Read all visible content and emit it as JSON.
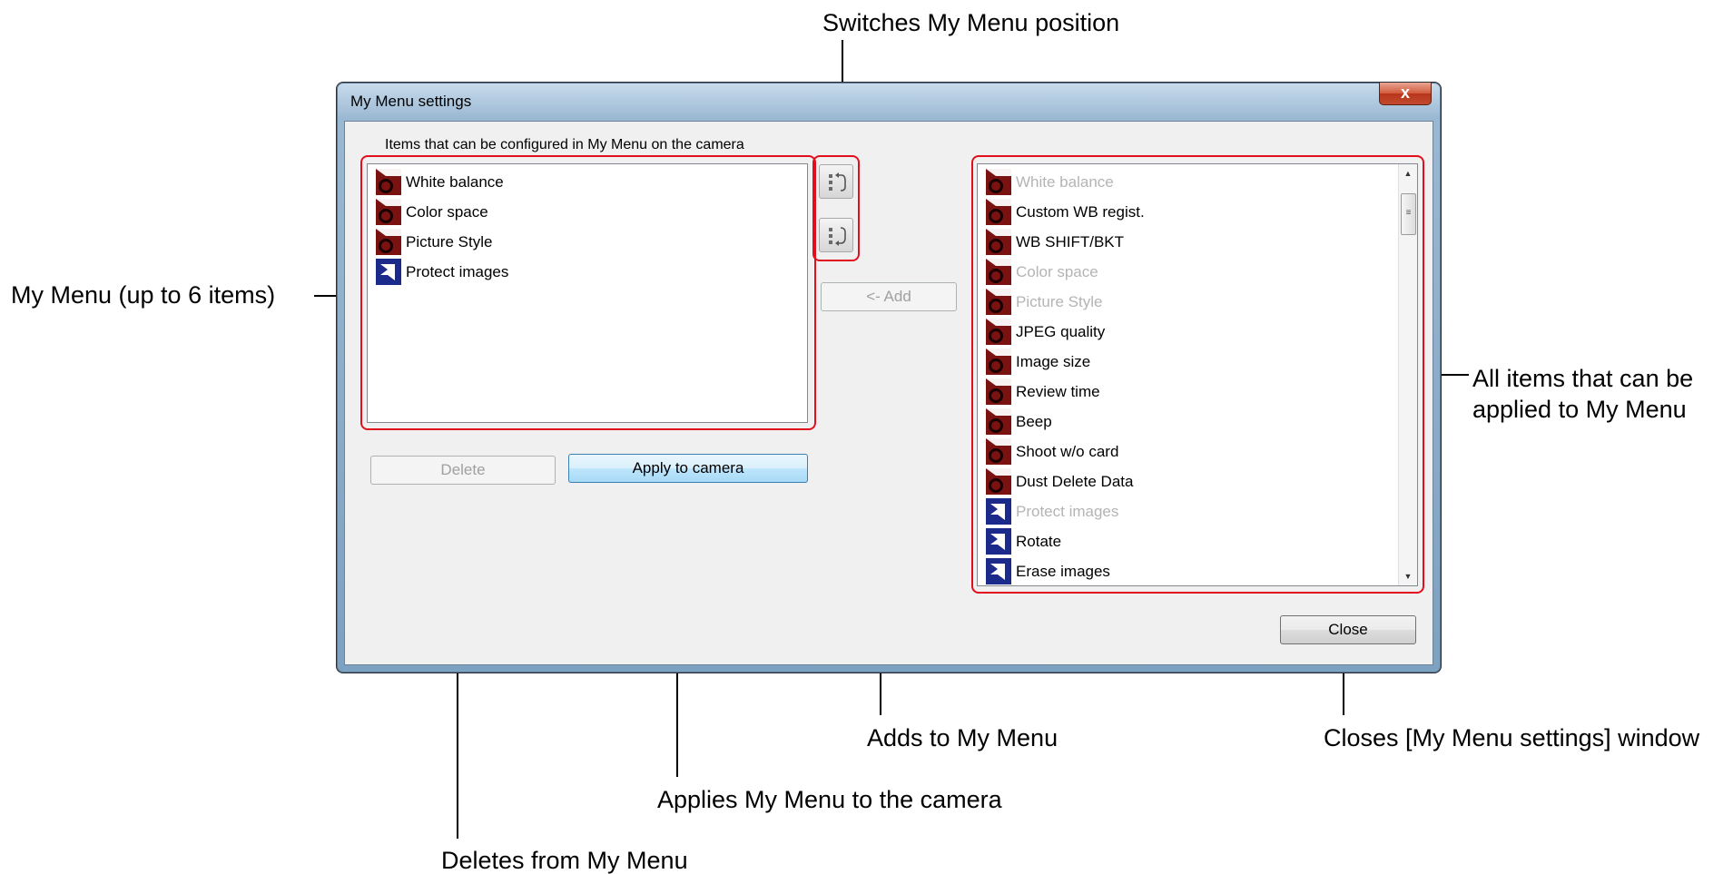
{
  "callouts": {
    "switch_position": "Switches My Menu position",
    "my_menu": "My Menu (up to 6 items)",
    "all_items_line1": "All items that can be",
    "all_items_line2": "applied to My Menu",
    "adds": "Adds to My Menu",
    "closes": "Closes [My Menu settings] window",
    "applies": "Applies My Menu to the camera",
    "deletes": "Deletes from My Menu"
  },
  "window": {
    "title": "My Menu settings",
    "close_glyph": "x",
    "section_label": "Items that can be configured in My Menu on the camera"
  },
  "my_menu_items": [
    {
      "label": "White balance",
      "icon": "camera-shooting-icon",
      "disabled": false
    },
    {
      "label": "Color space",
      "icon": "camera-shooting-icon",
      "disabled": false
    },
    {
      "label": "Picture Style",
      "icon": "camera-shooting-icon",
      "disabled": false
    },
    {
      "label": "Protect images",
      "icon": "playback-icon",
      "disabled": false
    }
  ],
  "all_items": [
    {
      "label": "White balance",
      "icon": "camera-shooting-icon",
      "disabled": true
    },
    {
      "label": "Custom WB regist.",
      "icon": "camera-shooting-icon",
      "disabled": false
    },
    {
      "label": "WB SHIFT/BKT",
      "icon": "camera-shooting-icon",
      "disabled": false
    },
    {
      "label": "Color space",
      "icon": "camera-shooting-icon",
      "disabled": true
    },
    {
      "label": "Picture Style",
      "icon": "camera-shooting-icon",
      "disabled": true
    },
    {
      "label": "JPEG quality",
      "icon": "camera-shooting-icon",
      "disabled": false
    },
    {
      "label": "Image size",
      "icon": "camera-shooting-icon",
      "disabled": false
    },
    {
      "label": "Review time",
      "icon": "camera-shooting-icon",
      "disabled": false
    },
    {
      "label": "Beep",
      "icon": "camera-shooting-icon",
      "disabled": false
    },
    {
      "label": "Shoot w/o card",
      "icon": "camera-shooting-icon",
      "disabled": false
    },
    {
      "label": "Dust Delete Data",
      "icon": "camera-shooting-icon",
      "disabled": false
    },
    {
      "label": "Protect images",
      "icon": "playback-icon",
      "disabled": true
    },
    {
      "label": "Rotate",
      "icon": "playback-icon",
      "disabled": false
    },
    {
      "label": "Erase images",
      "icon": "playback-icon",
      "disabled": false
    }
  ],
  "buttons": {
    "delete": "Delete",
    "apply": "Apply to camera",
    "add": "<- Add",
    "close": "Close"
  },
  "colors": {
    "highlight": "#e10f1e",
    "shooting_icon": "#7a1212",
    "playback_icon": "#1c2a8c"
  }
}
